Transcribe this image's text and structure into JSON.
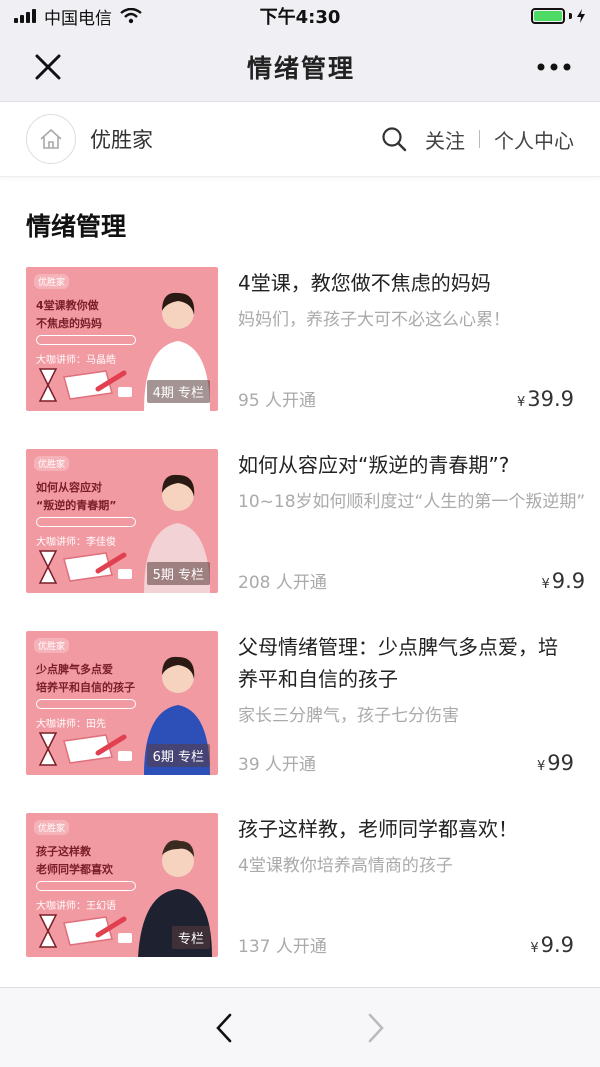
{
  "status_bar": {
    "carrier": "中国电信",
    "time": "下午4:30"
  },
  "nav": {
    "title": "情绪管理"
  },
  "shop": {
    "name": "优胜家",
    "follow_label": "关注",
    "profile_label": "个人中心"
  },
  "section": {
    "title": "情绪管理"
  },
  "courses": [
    {
      "title": "4堂课，教您做不焦虑的妈妈",
      "subtitle": "妈妈们，养孩子大可不必这么心累！",
      "count": "95 人开通",
      "currency": "¥",
      "price": "39.9",
      "badge": "4期 专栏",
      "thumb": {
        "logo": "优胜家",
        "line1": "4堂课教你做",
        "line2": "不焦虑的妈妈",
        "lecturer": "大咖讲师：马晶皓",
        "shirt": "#ffffff"
      }
    },
    {
      "title": "如何从容应对“叛逆的青春期”?",
      "subtitle": "10~18岁如何顺利度过“人生的第一个叛逆期”",
      "count": "208 人开通",
      "currency": "¥",
      "price": "9.9",
      "badge": "5期 专栏",
      "thumb": {
        "logo": "优胜家",
        "line1": "如何从容应对",
        "line2": "“叛逆的青春期”",
        "lecturer": "大咖讲师：李佳俊",
        "shirt": "#f3d2d6"
      }
    },
    {
      "title": "父母情绪管理：少点脾气多点爱，培养平和自信的孩子",
      "subtitle": "家长三分脾气，孩子七分伤害",
      "count": "39 人开通",
      "currency": "¥",
      "price": "99",
      "badge": "6期 专栏",
      "thumb": {
        "logo": "优胜家",
        "line1": "少点脾气多点爱",
        "line2": "培养平和自信的孩子",
        "lecturer": "大咖讲师：田先",
        "shirt": "#2d4fb8"
      }
    },
    {
      "title": "孩子这样教，老师同学都喜欢！",
      "subtitle": "4堂课教你培养高情商的孩子",
      "count": "137 人开通",
      "currency": "¥",
      "price": "9.9",
      "badge": "专栏",
      "thumb": {
        "logo": "优胜家",
        "line1": "孩子这样教",
        "line2": "老师同学都喜欢",
        "lecturer": "大咖讲师：王幻语",
        "shirt": "#1e2230"
      }
    }
  ],
  "colors": {
    "thumb_bg": "#f29aa2",
    "battery": "#4cd964"
  }
}
